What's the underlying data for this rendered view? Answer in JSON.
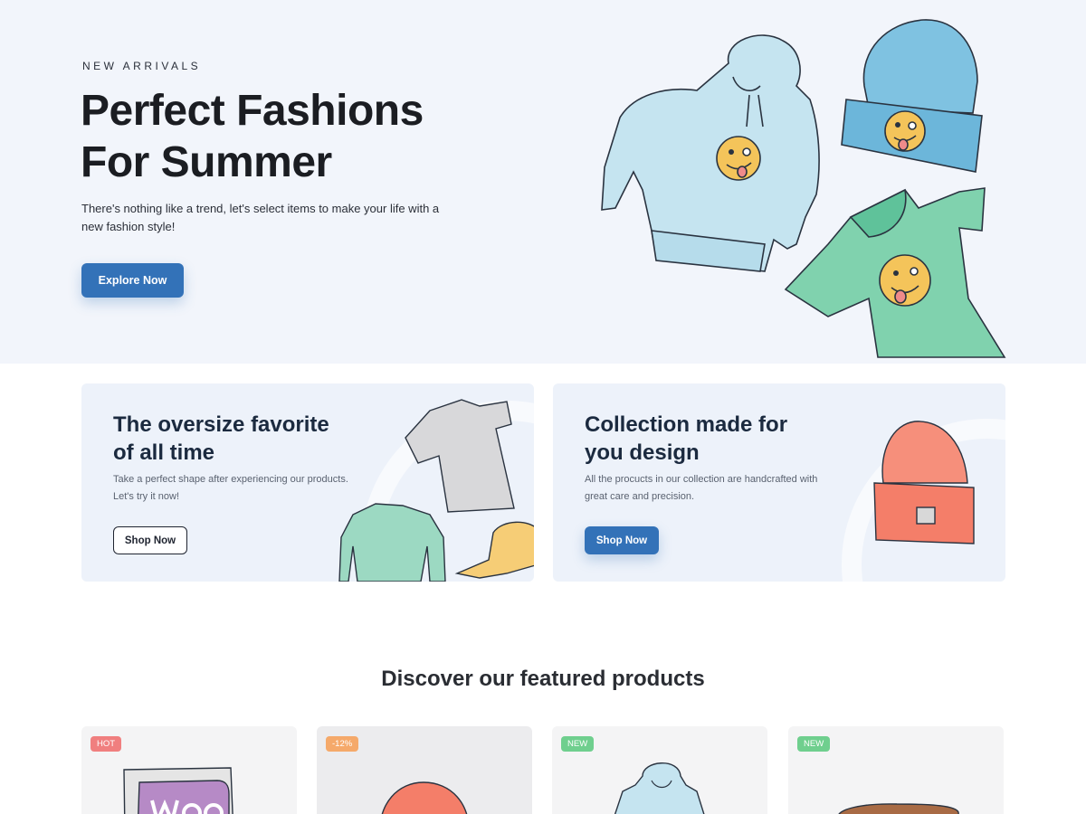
{
  "hero": {
    "eyebrow": "NEW ARRIVALS",
    "title_line1": "Perfect Fashions",
    "title_line2": "For Summer",
    "description": "There's nothing like a trend, let's select items to make your life with a new fashion style!",
    "cta_label": "Explore Now"
  },
  "promos": [
    {
      "title_line1": "The oversize favorite",
      "title_line2": "of all time",
      "desc_line1": "Take a perfect shape after experiencing our products.",
      "desc_line2": "Let's try it now!",
      "cta_label": "Shop Now"
    },
    {
      "title_line1": "Collection made for",
      "title_line2": "you design",
      "desc_line1": "All the procucts in our collection are handcrafted with",
      "desc_line2": "great care and precision.",
      "cta_label": "Shop Now"
    }
  ],
  "featured": {
    "title": "Discover our featured products",
    "products": [
      {
        "badge": "HOT",
        "image": "woo-poster"
      },
      {
        "badge": "-12%",
        "image": "red-beanie"
      },
      {
        "badge": "NEW",
        "image": "blue-hoodie"
      },
      {
        "badge": "NEW",
        "image": "brown-cap"
      }
    ]
  },
  "colors": {
    "accent": "#3372b8",
    "hero_bg": "#f2f5fb",
    "promo_bg": "#edf2fa",
    "badge_hot": "#f07f7f",
    "badge_sale": "#f5a96a",
    "badge_new": "#6fcf8e"
  }
}
